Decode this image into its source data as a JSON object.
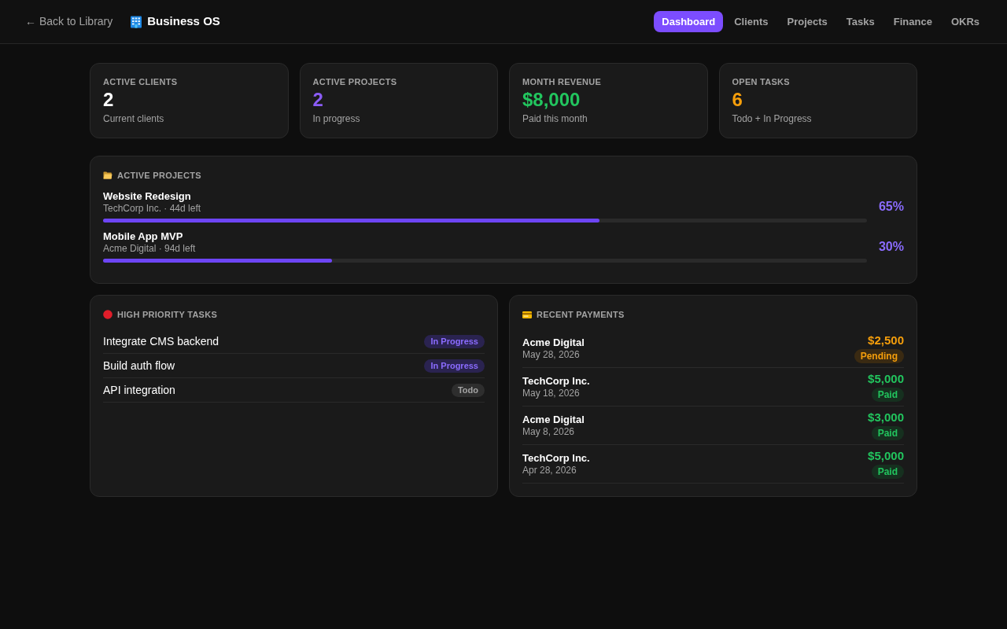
{
  "header": {
    "back_link": "← Back to Library",
    "app_title": "Business OS",
    "nav": [
      {
        "label": "Dashboard",
        "selected": true
      },
      {
        "label": "Clients",
        "selected": false
      },
      {
        "label": "Projects",
        "selected": false
      },
      {
        "label": "Tasks",
        "selected": false
      },
      {
        "label": "Finance",
        "selected": false
      },
      {
        "label": "OKRs",
        "selected": false
      }
    ]
  },
  "stats": [
    {
      "label": "ACTIVE CLIENTS",
      "value": "2",
      "caption": "Current clients",
      "color": "#ffffff"
    },
    {
      "label": "ACTIVE PROJECTS",
      "value": "2",
      "caption": "In progress",
      "color": "#8b5cf6"
    },
    {
      "label": "MONTH REVENUE",
      "value": "$8,000",
      "caption": "Paid this month",
      "color": "#22c55e"
    },
    {
      "label": "OPEN TASKS",
      "value": "6",
      "caption": "Todo + In Progress",
      "color": "#f59e0b"
    }
  ],
  "active_projects": {
    "title": "ACTIVE PROJECTS",
    "items": [
      {
        "name": "Website Redesign",
        "meta": "TechCorp Inc. · 44d left",
        "level": 0.65,
        "percent": "65%"
      },
      {
        "name": "Mobile App MVP",
        "meta": "Acme Digital · 94d left",
        "level": 0.3,
        "percent": "30%"
      }
    ]
  },
  "high_priority_tasks": {
    "title": "HIGH PRIORITY TASKS",
    "items": [
      {
        "name": "Integrate CMS backend",
        "status": "In Progress",
        "kind": "in_progress"
      },
      {
        "name": "Build auth flow",
        "status": "In Progress",
        "kind": "in_progress"
      },
      {
        "name": "API integration",
        "status": "Todo",
        "kind": "todo"
      }
    ]
  },
  "recent_payments": {
    "title": "RECENT PAYMENTS",
    "items": [
      {
        "client": "Acme Digital",
        "date": "May 28, 2026",
        "amount": "$2,500",
        "status": "Pending",
        "kind": "pending"
      },
      {
        "client": "TechCorp Inc.",
        "date": "May 18, 2026",
        "amount": "$5,000",
        "status": "Paid",
        "kind": "paid"
      },
      {
        "client": "Acme Digital",
        "date": "May 8, 2026",
        "amount": "$3,000",
        "status": "Paid",
        "kind": "paid"
      },
      {
        "client": "TechCorp Inc.",
        "date": "Apr 28, 2026",
        "amount": "$5,000",
        "status": "Paid",
        "kind": "paid"
      }
    ]
  }
}
